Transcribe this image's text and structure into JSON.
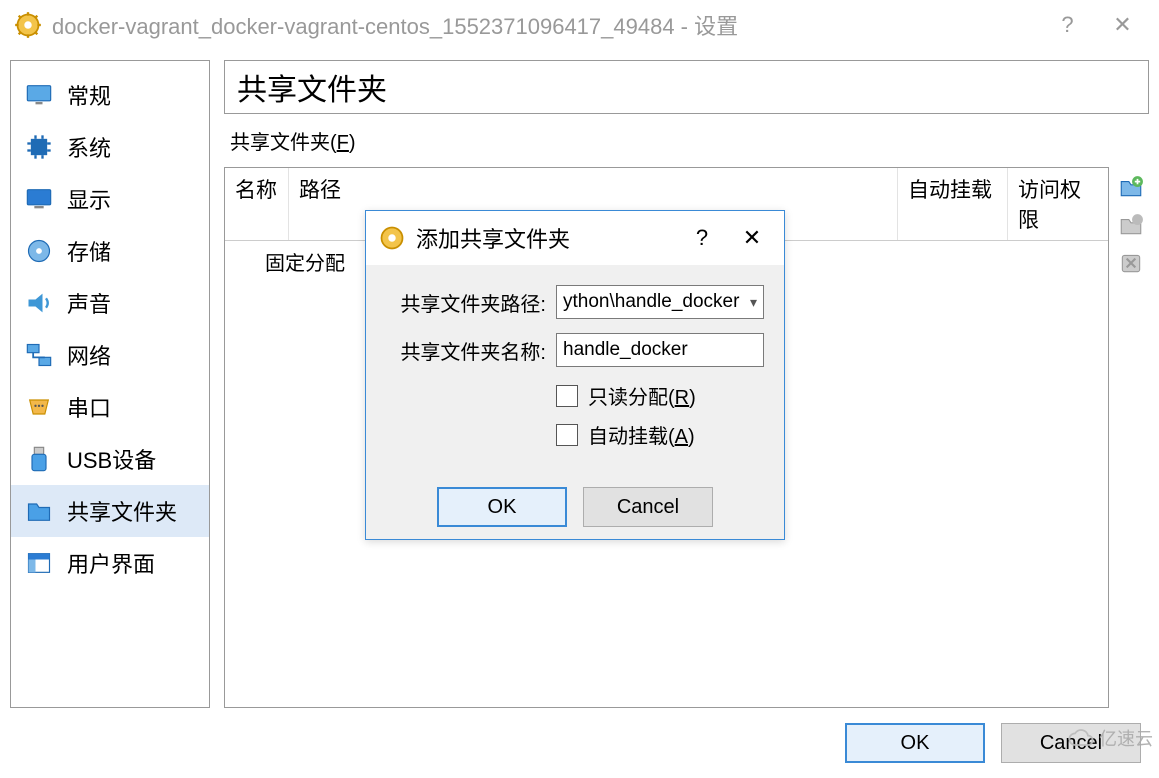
{
  "window": {
    "title": "docker-vagrant_docker-vagrant-centos_1552371096417_49484 - 设置"
  },
  "sidebar": {
    "items": [
      {
        "label": "常规"
      },
      {
        "label": "系统"
      },
      {
        "label": "显示"
      },
      {
        "label": "存储"
      },
      {
        "label": "声音"
      },
      {
        "label": "网络"
      },
      {
        "label": "串口"
      },
      {
        "label": "USB设备"
      },
      {
        "label": "共享文件夹"
      },
      {
        "label": "用户界面"
      }
    ]
  },
  "panel": {
    "title": "共享文件夹",
    "list_label_prefix": "共享文件夹(",
    "list_label_key": "F",
    "list_label_suffix": ")",
    "columns": {
      "name": "名称",
      "path": "路径",
      "automount": "自动挂载",
      "access": "访问权限"
    },
    "group_row": "固定分配"
  },
  "modal": {
    "title": "添加共享文件夹",
    "fields": {
      "path_label": "共享文件夹路径:",
      "path_value": "ython\\handle_docker",
      "name_label": "共享文件夹名称:",
      "name_value": "handle_docker"
    },
    "checks": {
      "readonly_prefix": "只读分配(",
      "readonly_key": "R",
      "readonly_suffix": ")",
      "automount_prefix": "自动挂载(",
      "automount_key": "A",
      "automount_suffix": ")"
    },
    "buttons": {
      "ok": "OK",
      "cancel": "Cancel"
    }
  },
  "footer": {
    "ok": "OK",
    "cancel": "Cancel"
  },
  "watermark": "亿速云"
}
